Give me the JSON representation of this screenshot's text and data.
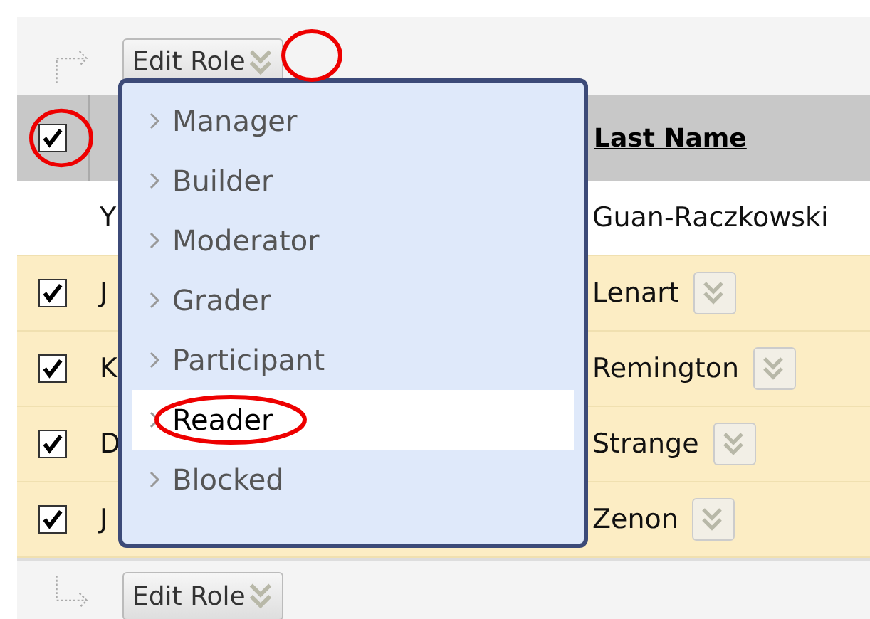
{
  "top_action": {
    "button": "Edit Role"
  },
  "table": {
    "select_all_checked": true,
    "columns": [
      {
        "label": "Last Name"
      }
    ],
    "rows": [
      {
        "has_checkbox": false,
        "checked": false,
        "first_name": "Y",
        "last_name": "Guan-Raczkowski",
        "menu_button": false
      },
      {
        "has_checkbox": true,
        "checked": true,
        "first_name": "J",
        "last_name": "Lenart",
        "menu_button": true
      },
      {
        "has_checkbox": true,
        "checked": true,
        "first_name": "K",
        "last_name": "Remington",
        "menu_button": true
      },
      {
        "has_checkbox": true,
        "checked": true,
        "first_name": "D",
        "last_name": "Strange",
        "menu_button": true
      },
      {
        "has_checkbox": true,
        "checked": true,
        "first_name": "J",
        "last_name": "Zenon",
        "menu_button": true
      }
    ]
  },
  "bottom_action": {
    "button": "Edit Role"
  },
  "role_menu": {
    "items": [
      {
        "label": "Manager",
        "selected": false
      },
      {
        "label": "Builder",
        "selected": false
      },
      {
        "label": "Moderator",
        "selected": false
      },
      {
        "label": "Grader",
        "selected": false
      },
      {
        "label": "Participant",
        "selected": false
      },
      {
        "label": "Reader",
        "selected": true
      },
      {
        "label": "Blocked",
        "selected": false
      }
    ]
  }
}
